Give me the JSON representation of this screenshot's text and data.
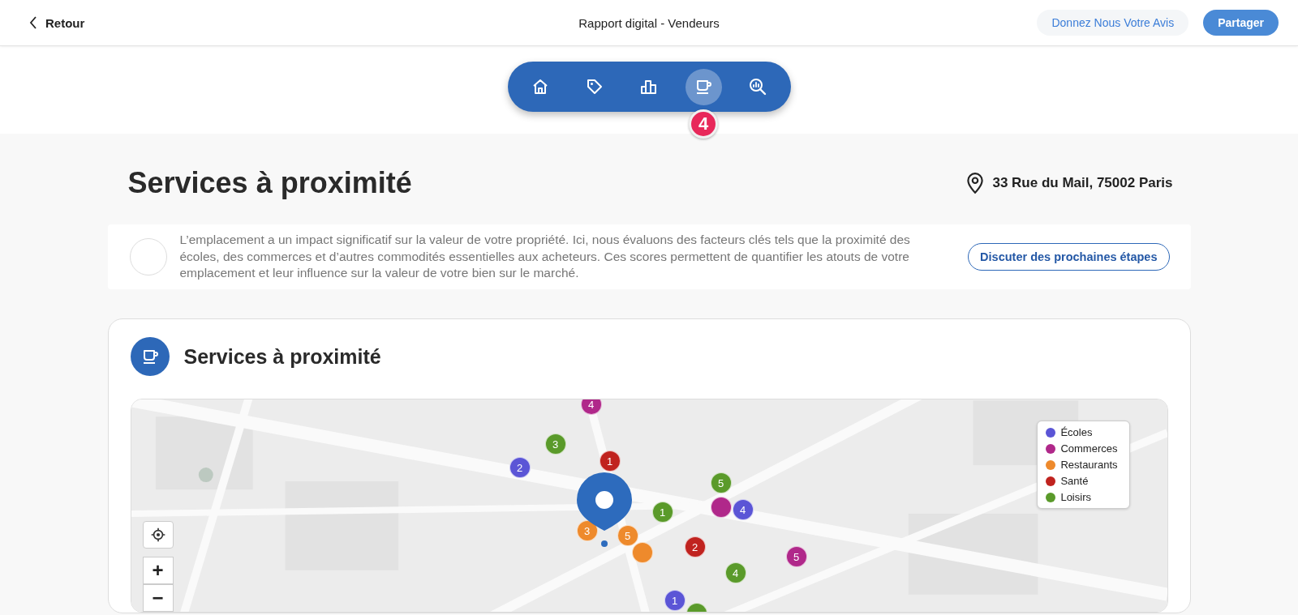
{
  "header": {
    "back": "Retour",
    "title": "Rapport digital - Vendeurs",
    "feedback": "Donnez Nous Votre Avis",
    "share": "Partager"
  },
  "nav": {
    "items": [
      {
        "kind": "home",
        "selected": false
      },
      {
        "kind": "tag",
        "selected": false
      },
      {
        "kind": "chart",
        "selected": false
      },
      {
        "kind": "cup",
        "selected": true
      },
      {
        "kind": "search",
        "selected": false
      }
    ],
    "badge": "4"
  },
  "page": {
    "title": "Services à proximité",
    "address": "33 Rue du Mail, 75002 Paris"
  },
  "intro": {
    "text": "L’emplacement a un impact significatif sur la valeur de votre propriété. Ici, nous évaluons des facteurs clés tels que la proximité des écoles, des commerces et d’autres commodités essentielles aux acheteurs. Ces scores permettent de quantifier les atouts de votre emplacement et leur influence sur la valeur de votre bien sur le marché.",
    "button": "Discuter des prochaines étapes"
  },
  "section": {
    "title": "Services à proximité",
    "map": {
      "kind": "picture",
      "legend": [
        {
          "label": "Écoles",
          "color": "#5b55d6"
        },
        {
          "label": "Commerces",
          "color": "#b0288a"
        },
        {
          "label": "Restaurants",
          "color": "#ee8a2c"
        },
        {
          "label": "Santé",
          "color": "#c0231f"
        },
        {
          "label": "Loisirs",
          "color": "#5a9a2a"
        }
      ],
      "markers": [
        {
          "label": "4",
          "color": "#b0288a"
        },
        {
          "label": "3",
          "color": "#5a9a2a"
        },
        {
          "label": "2",
          "color": "#5b55d6"
        },
        {
          "label": "1",
          "color": "#c0231f"
        },
        {
          "label": "5",
          "color": "#5a9a2a"
        },
        {
          "label": "1",
          "color": "#5a9a2a"
        },
        {
          "color": "#b0288a"
        },
        {
          "label": "4",
          "color": "#5b55d6"
        },
        {
          "label": "3",
          "color": "#ee8a2c"
        },
        {
          "color": "#ee8a2c"
        },
        {
          "label": "5",
          "color": "#ee8a2c"
        },
        {
          "label": "2",
          "color": "#c0231f"
        },
        {
          "label": "5",
          "color": "#b0288a"
        },
        {
          "label": "4",
          "color": "#5a9a2a"
        },
        {
          "label": "1",
          "color": "#5b55d6"
        },
        {
          "color": "#5a9a2a"
        }
      ],
      "controls": {
        "zoom_in": "+",
        "zoom_out": "−"
      }
    }
  }
}
